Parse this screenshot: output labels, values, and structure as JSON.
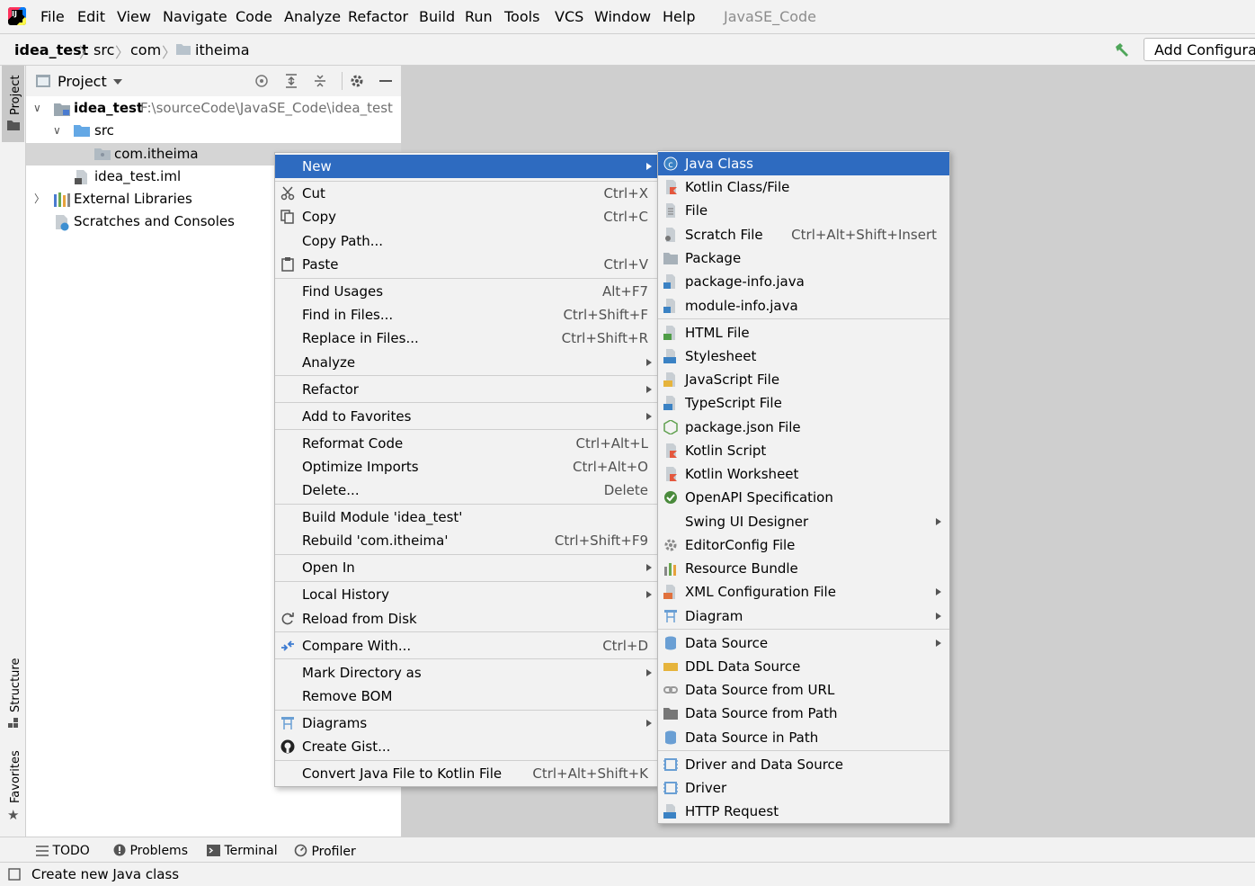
{
  "menubar": {
    "items": [
      "File",
      "Edit",
      "View",
      "Navigate",
      "Code",
      "Analyze",
      "Refactor",
      "Build",
      "Run",
      "Tools",
      "VCS",
      "Window",
      "Help"
    ],
    "project_title": "JavaSE_Code"
  },
  "navbar": {
    "crumbs": [
      "idea_test",
      "src",
      "com",
      "itheima"
    ],
    "add_config": "Add Configurat"
  },
  "side_tabs": {
    "project": "Project",
    "structure": "Structure",
    "favorites": "Favorites"
  },
  "project_panel": {
    "title": "Project",
    "tree": [
      {
        "label": "idea_test",
        "path": "F:\\sourceCode\\JavaSE_Code\\idea_test"
      },
      {
        "label": "src"
      },
      {
        "label": "com.itheima"
      },
      {
        "label": "idea_test.iml"
      },
      {
        "label": "External Libraries"
      },
      {
        "label": "Scratches and Consoles"
      }
    ]
  },
  "context_menu": {
    "items": [
      {
        "label": "New",
        "shortcut": "",
        "submenu": true
      },
      {
        "label": "Cut",
        "shortcut": "Ctrl+X"
      },
      {
        "label": "Copy",
        "shortcut": "Ctrl+C"
      },
      {
        "label": "Copy Path...",
        "shortcut": ""
      },
      {
        "label": "Paste",
        "shortcut": "Ctrl+V"
      },
      {
        "label": "Find Usages",
        "shortcut": "Alt+F7"
      },
      {
        "label": "Find in Files...",
        "shortcut": "Ctrl+Shift+F"
      },
      {
        "label": "Replace in Files...",
        "shortcut": "Ctrl+Shift+R"
      },
      {
        "label": "Analyze",
        "submenu": true
      },
      {
        "label": "Refactor",
        "submenu": true
      },
      {
        "label": "Add to Favorites",
        "submenu": true
      },
      {
        "label": "Reformat Code",
        "shortcut": "Ctrl+Alt+L"
      },
      {
        "label": "Optimize Imports",
        "shortcut": "Ctrl+Alt+O"
      },
      {
        "label": "Delete...",
        "shortcut": "Delete"
      },
      {
        "label": "Build Module 'idea_test'",
        "shortcut": ""
      },
      {
        "label": "Rebuild 'com.itheima'",
        "shortcut": "Ctrl+Shift+F9"
      },
      {
        "label": "Open In",
        "submenu": true
      },
      {
        "label": "Local History",
        "submenu": true
      },
      {
        "label": "Reload from Disk",
        "shortcut": ""
      },
      {
        "label": "Compare With...",
        "shortcut": "Ctrl+D"
      },
      {
        "label": "Mark Directory as",
        "submenu": true
      },
      {
        "label": "Remove BOM",
        "shortcut": ""
      },
      {
        "label": "Diagrams",
        "submenu": true
      },
      {
        "label": "Create Gist...",
        "shortcut": ""
      },
      {
        "label": "Convert Java File to Kotlin File",
        "shortcut": "Ctrl+Alt+Shift+K"
      }
    ]
  },
  "new_submenu": {
    "items": [
      {
        "label": "Java Class"
      },
      {
        "label": "Kotlin Class/File"
      },
      {
        "label": "File"
      },
      {
        "label": "Scratch File",
        "shortcut": "Ctrl+Alt+Shift+Insert"
      },
      {
        "label": "Package"
      },
      {
        "label": "package-info.java"
      },
      {
        "label": "module-info.java"
      },
      {
        "label": "HTML File"
      },
      {
        "label": "Stylesheet"
      },
      {
        "label": "JavaScript File"
      },
      {
        "label": "TypeScript File"
      },
      {
        "label": "package.json File"
      },
      {
        "label": "Kotlin Script"
      },
      {
        "label": "Kotlin Worksheet"
      },
      {
        "label": "OpenAPI Specification"
      },
      {
        "label": "Swing UI Designer",
        "submenu": true
      },
      {
        "label": "EditorConfig File"
      },
      {
        "label": "Resource Bundle"
      },
      {
        "label": "XML Configuration File",
        "submenu": true
      },
      {
        "label": "Diagram",
        "submenu": true
      },
      {
        "label": "Data Source",
        "submenu": true
      },
      {
        "label": "DDL Data Source"
      },
      {
        "label": "Data Source from URL"
      },
      {
        "label": "Data Source from Path"
      },
      {
        "label": "Data Source in Path"
      },
      {
        "label": "Driver and Data Source"
      },
      {
        "label": "Driver"
      },
      {
        "label": "HTTP Request"
      }
    ]
  },
  "tool_tabs": [
    "TODO",
    "Problems",
    "Terminal",
    "Profiler"
  ],
  "status": "Create new Java class",
  "colors": {
    "selection": "#2e6bc0",
    "background": "#f2f2f2",
    "editor": "#cfcfcf"
  }
}
